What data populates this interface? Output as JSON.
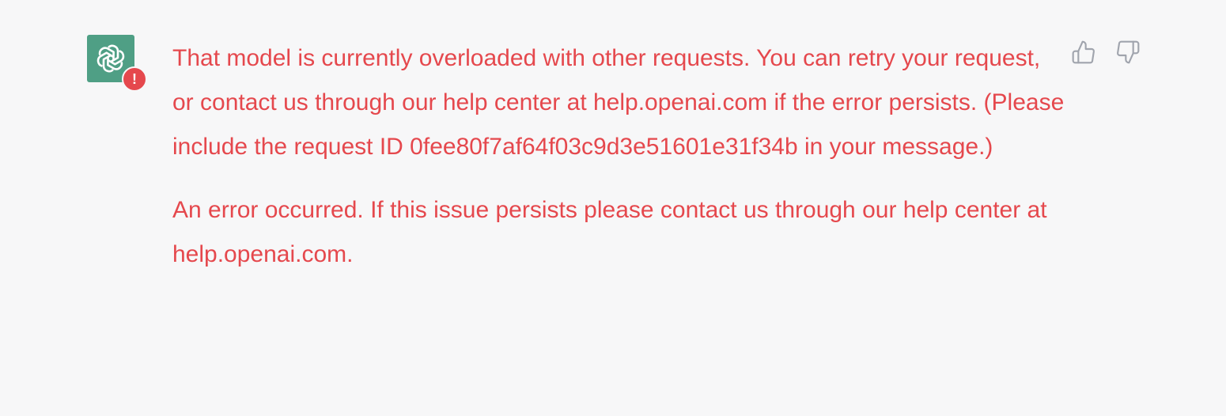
{
  "message": {
    "paragraphs": [
      "That model is currently overloaded with other requests. You can retry your request, or contact us through our help center at help.openai.com if the error persists. (Please include the request ID 0fee80f7af64f03c9d3e51601e31f34b in your message.)",
      "An error occurred. If this issue persists please contact us through our help center at help.openai.com."
    ],
    "text_color": "#e5484d"
  },
  "avatar": {
    "icon": "openai-logo-icon",
    "background": "#4f9f85",
    "badge_icon": "error-icon",
    "badge_text": "!"
  },
  "feedback": {
    "thumbs_up_icon": "thumbs-up-icon",
    "thumbs_down_icon": "thumbs-down-icon"
  }
}
